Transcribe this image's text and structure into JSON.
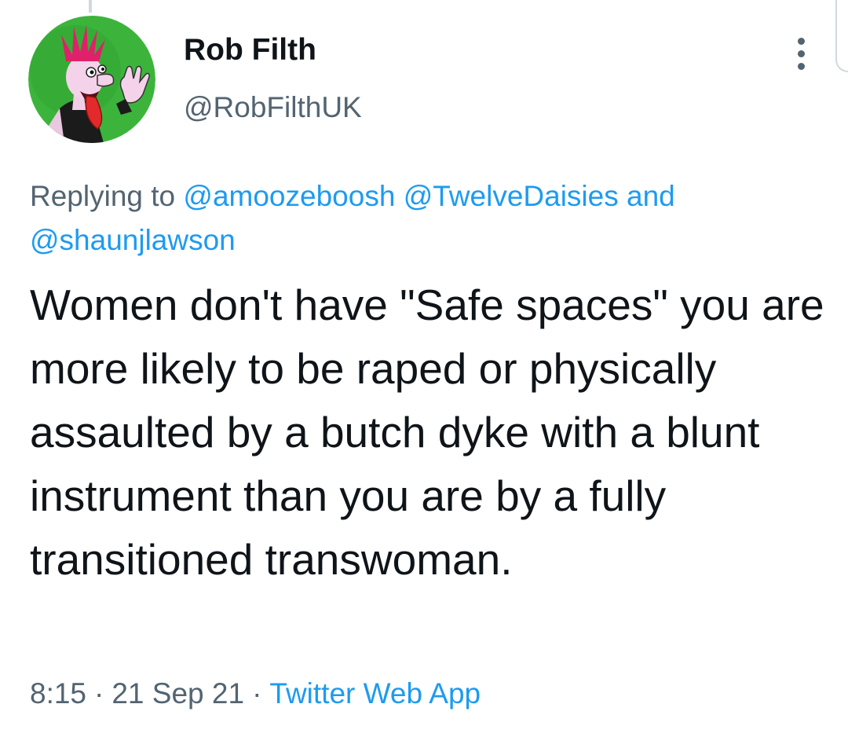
{
  "author": {
    "display_name": "Rob Filth",
    "handle": "@RobFilthUK",
    "avatar_icon": "punk-cartoon-avatar",
    "avatar_bg": "#3cb43c"
  },
  "reply_context": {
    "prefix": "Replying to",
    "mentions": [
      "@amoozeboosh",
      "@TwelveDaisies"
    ],
    "conjunction": "and",
    "last_mention": "@shaunjlawson"
  },
  "tweet": {
    "text": "Women don't have \"Safe spaces\" you are more likely to be raped or physically assaulted by a butch dyke with a blunt instrument than you are by a fully transitioned transwoman."
  },
  "meta": {
    "time": "8:15",
    "separator": "·",
    "date": "21 Sep 21",
    "source": "Twitter Web App"
  },
  "actions": {
    "more_icon": "more-vertical-icon"
  },
  "colors": {
    "text": "#0f1419",
    "secondary": "#536471",
    "accent": "#1d9bf0"
  }
}
